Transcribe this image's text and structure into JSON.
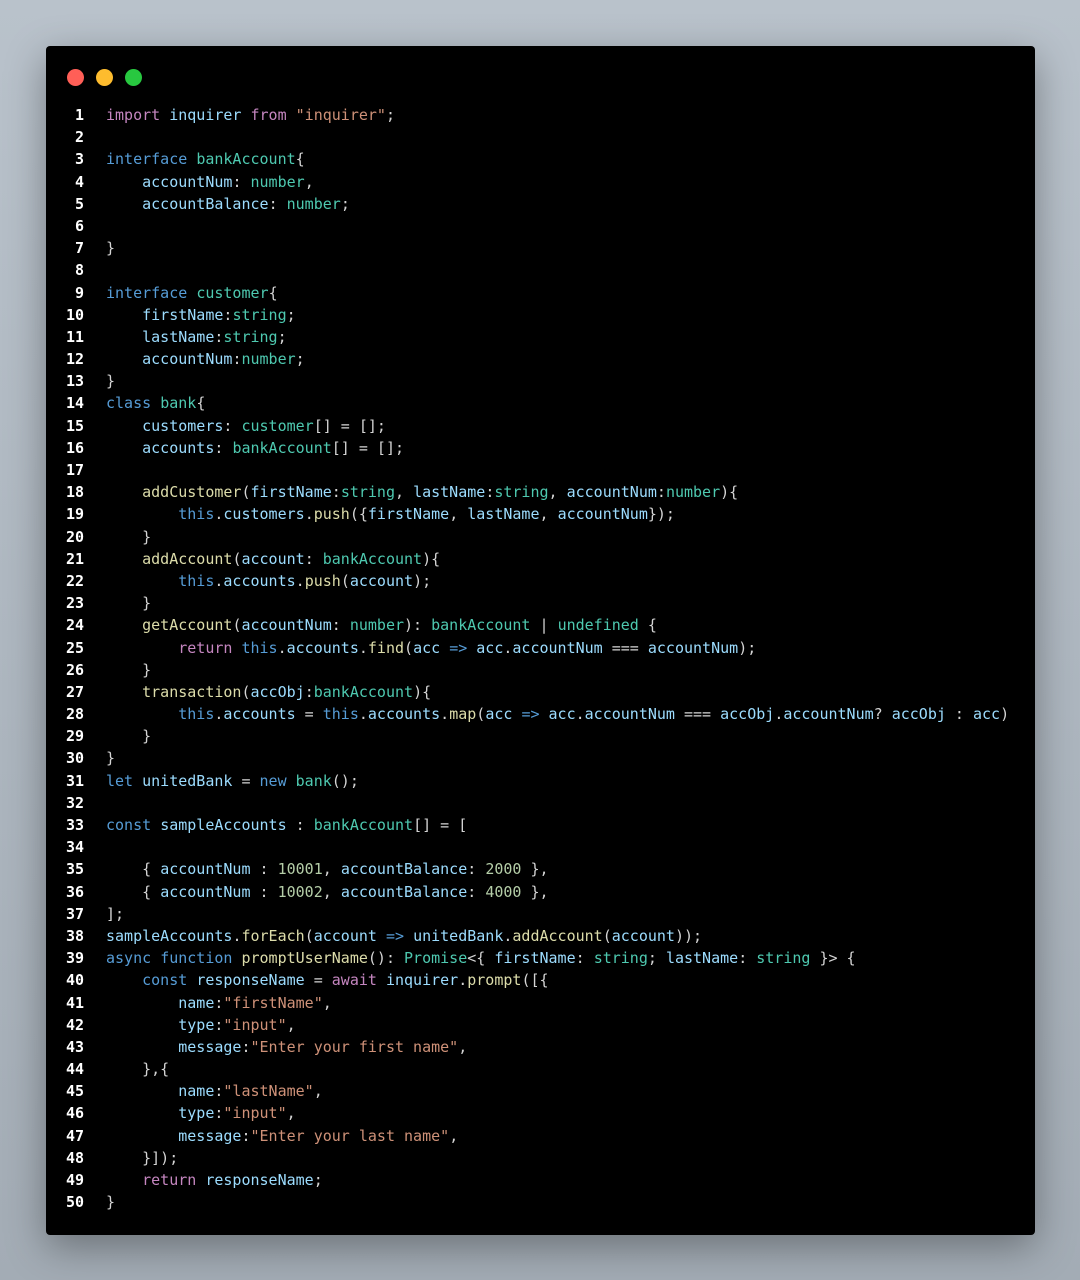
{
  "window": {
    "buttons": [
      "close",
      "minimize",
      "maximize"
    ],
    "colors": {
      "close": "#ff5f57",
      "minimize": "#febc2e",
      "maximize": "#28c840",
      "background": "#000000"
    }
  },
  "code": {
    "language": "typescript",
    "lines": [
      [
        [
          "kw",
          "import"
        ],
        [
          "pl",
          " "
        ],
        [
          "vr",
          "inquirer"
        ],
        [
          "pl",
          " "
        ],
        [
          "kw",
          "from"
        ],
        [
          "pl",
          " "
        ],
        [
          "st",
          "\"inquirer\""
        ],
        [
          "pl",
          ";"
        ]
      ],
      [],
      [
        [
          "kb",
          "interface"
        ],
        [
          "pl",
          " "
        ],
        [
          "ty",
          "bankAccount"
        ],
        [
          "pl",
          "{"
        ]
      ],
      [
        [
          "pl",
          "    "
        ],
        [
          "vr",
          "accountNum"
        ],
        [
          "pl",
          ": "
        ],
        [
          "ty",
          "number"
        ],
        [
          "pl",
          ","
        ]
      ],
      [
        [
          "pl",
          "    "
        ],
        [
          "vr",
          "accountBalance"
        ],
        [
          "pl",
          ": "
        ],
        [
          "ty",
          "number"
        ],
        [
          "pl",
          ";"
        ]
      ],
      [],
      [
        [
          "pl",
          "}"
        ]
      ],
      [],
      [
        [
          "kb",
          "interface"
        ],
        [
          "pl",
          " "
        ],
        [
          "ty",
          "customer"
        ],
        [
          "pl",
          "{"
        ]
      ],
      [
        [
          "pl",
          "    "
        ],
        [
          "vr",
          "firstName"
        ],
        [
          "pl",
          ":"
        ],
        [
          "ty",
          "string"
        ],
        [
          "pl",
          ";"
        ]
      ],
      [
        [
          "pl",
          "    "
        ],
        [
          "vr",
          "lastName"
        ],
        [
          "pl",
          ":"
        ],
        [
          "ty",
          "string"
        ],
        [
          "pl",
          ";"
        ]
      ],
      [
        [
          "pl",
          "    "
        ],
        [
          "vr",
          "accountNum"
        ],
        [
          "pl",
          ":"
        ],
        [
          "ty",
          "number"
        ],
        [
          "pl",
          ";"
        ]
      ],
      [
        [
          "pl",
          "}"
        ]
      ],
      [
        [
          "kb",
          "class"
        ],
        [
          "pl",
          " "
        ],
        [
          "ty",
          "bank"
        ],
        [
          "pl",
          "{"
        ]
      ],
      [
        [
          "pl",
          "    "
        ],
        [
          "vr",
          "customers"
        ],
        [
          "pl",
          ": "
        ],
        [
          "ty",
          "customer"
        ],
        [
          "pl",
          "[] = [];"
        ]
      ],
      [
        [
          "pl",
          "    "
        ],
        [
          "vr",
          "accounts"
        ],
        [
          "pl",
          ": "
        ],
        [
          "ty",
          "bankAccount"
        ],
        [
          "pl",
          "[] = [];"
        ]
      ],
      [],
      [
        [
          "pl",
          "    "
        ],
        [
          "fn",
          "addCustomer"
        ],
        [
          "pl",
          "("
        ],
        [
          "vr",
          "firstName"
        ],
        [
          "pl",
          ":"
        ],
        [
          "ty",
          "string"
        ],
        [
          "pl",
          ", "
        ],
        [
          "vr",
          "lastName"
        ],
        [
          "pl",
          ":"
        ],
        [
          "ty",
          "string"
        ],
        [
          "pl",
          ", "
        ],
        [
          "vr",
          "accountNum"
        ],
        [
          "pl",
          ":"
        ],
        [
          "ty",
          "number"
        ],
        [
          "pl",
          "){"
        ]
      ],
      [
        [
          "pl",
          "        "
        ],
        [
          "kb",
          "this"
        ],
        [
          "pl",
          "."
        ],
        [
          "vr",
          "customers"
        ],
        [
          "pl",
          "."
        ],
        [
          "fn",
          "push"
        ],
        [
          "pl",
          "({"
        ],
        [
          "vr",
          "firstName"
        ],
        [
          "pl",
          ", "
        ],
        [
          "vr",
          "lastName"
        ],
        [
          "pl",
          ", "
        ],
        [
          "vr",
          "accountNum"
        ],
        [
          "pl",
          "});"
        ]
      ],
      [
        [
          "pl",
          "    }"
        ]
      ],
      [
        [
          "pl",
          "    "
        ],
        [
          "fn",
          "addAccount"
        ],
        [
          "pl",
          "("
        ],
        [
          "vr",
          "account"
        ],
        [
          "pl",
          ": "
        ],
        [
          "ty",
          "bankAccount"
        ],
        [
          "pl",
          "){"
        ]
      ],
      [
        [
          "pl",
          "        "
        ],
        [
          "kb",
          "this"
        ],
        [
          "pl",
          "."
        ],
        [
          "vr",
          "accounts"
        ],
        [
          "pl",
          "."
        ],
        [
          "fn",
          "push"
        ],
        [
          "pl",
          "("
        ],
        [
          "vr",
          "account"
        ],
        [
          "pl",
          ");"
        ]
      ],
      [
        [
          "pl",
          "    }"
        ]
      ],
      [
        [
          "pl",
          "    "
        ],
        [
          "fn",
          "getAccount"
        ],
        [
          "pl",
          "("
        ],
        [
          "vr",
          "accountNum"
        ],
        [
          "pl",
          ": "
        ],
        [
          "ty",
          "number"
        ],
        [
          "pl",
          "): "
        ],
        [
          "ty",
          "bankAccount"
        ],
        [
          "pl",
          " | "
        ],
        [
          "ty",
          "undefined"
        ],
        [
          "pl",
          " {"
        ]
      ],
      [
        [
          "pl",
          "        "
        ],
        [
          "kw",
          "return"
        ],
        [
          "pl",
          " "
        ],
        [
          "kb",
          "this"
        ],
        [
          "pl",
          "."
        ],
        [
          "vr",
          "accounts"
        ],
        [
          "pl",
          "."
        ],
        [
          "fn",
          "find"
        ],
        [
          "pl",
          "("
        ],
        [
          "vr",
          "acc"
        ],
        [
          "pl",
          " "
        ],
        [
          "kb",
          "=>"
        ],
        [
          "pl",
          " "
        ],
        [
          "vr",
          "acc"
        ],
        [
          "pl",
          "."
        ],
        [
          "vr",
          "accountNum"
        ],
        [
          "pl",
          " === "
        ],
        [
          "vr",
          "accountNum"
        ],
        [
          "pl",
          ");"
        ]
      ],
      [
        [
          "pl",
          "    }"
        ]
      ],
      [
        [
          "pl",
          "    "
        ],
        [
          "fn",
          "transaction"
        ],
        [
          "pl",
          "("
        ],
        [
          "vr",
          "accObj"
        ],
        [
          "pl",
          ":"
        ],
        [
          "ty",
          "bankAccount"
        ],
        [
          "pl",
          "){"
        ]
      ],
      [
        [
          "pl",
          "        "
        ],
        [
          "kb",
          "this"
        ],
        [
          "pl",
          "."
        ],
        [
          "vr",
          "accounts"
        ],
        [
          "pl",
          " = "
        ],
        [
          "kb",
          "this"
        ],
        [
          "pl",
          "."
        ],
        [
          "vr",
          "accounts"
        ],
        [
          "pl",
          "."
        ],
        [
          "fn",
          "map"
        ],
        [
          "pl",
          "("
        ],
        [
          "vr",
          "acc"
        ],
        [
          "pl",
          " "
        ],
        [
          "kb",
          "=>"
        ],
        [
          "pl",
          " "
        ],
        [
          "vr",
          "acc"
        ],
        [
          "pl",
          "."
        ],
        [
          "vr",
          "accountNum"
        ],
        [
          "pl",
          " === "
        ],
        [
          "vr",
          "accObj"
        ],
        [
          "pl",
          "."
        ],
        [
          "vr",
          "accountNum"
        ],
        [
          "pl",
          "? "
        ],
        [
          "vr",
          "accObj"
        ],
        [
          "pl",
          " : "
        ],
        [
          "vr",
          "acc"
        ],
        [
          "pl",
          ")"
        ]
      ],
      [
        [
          "pl",
          "    }"
        ]
      ],
      [
        [
          "pl",
          "}"
        ]
      ],
      [
        [
          "kb",
          "let"
        ],
        [
          "pl",
          " "
        ],
        [
          "vr",
          "unitedBank"
        ],
        [
          "pl",
          " = "
        ],
        [
          "kb",
          "new"
        ],
        [
          "pl",
          " "
        ],
        [
          "ty",
          "bank"
        ],
        [
          "pl",
          "();"
        ]
      ],
      [],
      [
        [
          "kb",
          "const"
        ],
        [
          "pl",
          " "
        ],
        [
          "vr",
          "sampleAccounts"
        ],
        [
          "pl",
          " : "
        ],
        [
          "ty",
          "bankAccount"
        ],
        [
          "pl",
          "[] = ["
        ]
      ],
      [],
      [
        [
          "pl",
          "    { "
        ],
        [
          "vr",
          "accountNum"
        ],
        [
          "pl",
          " : "
        ],
        [
          "nm",
          "10001"
        ],
        [
          "pl",
          ", "
        ],
        [
          "vr",
          "accountBalance"
        ],
        [
          "pl",
          ": "
        ],
        [
          "nm",
          "2000"
        ],
        [
          "pl",
          " },"
        ]
      ],
      [
        [
          "pl",
          "    { "
        ],
        [
          "vr",
          "accountNum"
        ],
        [
          "pl",
          " : "
        ],
        [
          "nm",
          "10002"
        ],
        [
          "pl",
          ", "
        ],
        [
          "vr",
          "accountBalance"
        ],
        [
          "pl",
          ": "
        ],
        [
          "nm",
          "4000"
        ],
        [
          "pl",
          " },"
        ]
      ],
      [
        [
          "pl",
          "];"
        ]
      ],
      [
        [
          "vr",
          "sampleAccounts"
        ],
        [
          "pl",
          "."
        ],
        [
          "fn",
          "forEach"
        ],
        [
          "pl",
          "("
        ],
        [
          "vr",
          "account"
        ],
        [
          "pl",
          " "
        ],
        [
          "kb",
          "=>"
        ],
        [
          "pl",
          " "
        ],
        [
          "vr",
          "unitedBank"
        ],
        [
          "pl",
          "."
        ],
        [
          "fn",
          "addAccount"
        ],
        [
          "pl",
          "("
        ],
        [
          "vr",
          "account"
        ],
        [
          "pl",
          "));"
        ]
      ],
      [
        [
          "kb",
          "async"
        ],
        [
          "pl",
          " "
        ],
        [
          "kb",
          "function"
        ],
        [
          "pl",
          " "
        ],
        [
          "fn",
          "promptUserName"
        ],
        [
          "pl",
          "(): "
        ],
        [
          "ty",
          "Promise"
        ],
        [
          "pl",
          "<{ "
        ],
        [
          "vr",
          "firstName"
        ],
        [
          "pl",
          ": "
        ],
        [
          "ty",
          "string"
        ],
        [
          "pl",
          "; "
        ],
        [
          "vr",
          "lastName"
        ],
        [
          "pl",
          ": "
        ],
        [
          "ty",
          "string"
        ],
        [
          "pl",
          " }> {"
        ]
      ],
      [
        [
          "pl",
          "    "
        ],
        [
          "kb",
          "const"
        ],
        [
          "pl",
          " "
        ],
        [
          "vr",
          "responseName"
        ],
        [
          "pl",
          " = "
        ],
        [
          "kw",
          "await"
        ],
        [
          "pl",
          " "
        ],
        [
          "vr",
          "inquirer"
        ],
        [
          "pl",
          "."
        ],
        [
          "fn",
          "prompt"
        ],
        [
          "pl",
          "([{"
        ]
      ],
      [
        [
          "pl",
          "        "
        ],
        [
          "vr",
          "name"
        ],
        [
          "pl",
          ":"
        ],
        [
          "st",
          "\"firstName\""
        ],
        [
          "pl",
          ","
        ]
      ],
      [
        [
          "pl",
          "        "
        ],
        [
          "vr",
          "type"
        ],
        [
          "pl",
          ":"
        ],
        [
          "st",
          "\"input\""
        ],
        [
          "pl",
          ","
        ]
      ],
      [
        [
          "pl",
          "        "
        ],
        [
          "vr",
          "message"
        ],
        [
          "pl",
          ":"
        ],
        [
          "st",
          "\"Enter your first name\""
        ],
        [
          "pl",
          ","
        ]
      ],
      [
        [
          "pl",
          "    },{"
        ]
      ],
      [
        [
          "pl",
          "        "
        ],
        [
          "vr",
          "name"
        ],
        [
          "pl",
          ":"
        ],
        [
          "st",
          "\"lastName\""
        ],
        [
          "pl",
          ","
        ]
      ],
      [
        [
          "pl",
          "        "
        ],
        [
          "vr",
          "type"
        ],
        [
          "pl",
          ":"
        ],
        [
          "st",
          "\"input\""
        ],
        [
          "pl",
          ","
        ]
      ],
      [
        [
          "pl",
          "        "
        ],
        [
          "vr",
          "message"
        ],
        [
          "pl",
          ":"
        ],
        [
          "st",
          "\"Enter your last name\""
        ],
        [
          "pl",
          ","
        ]
      ],
      [
        [
          "pl",
          "    }]);"
        ]
      ],
      [
        [
          "pl",
          "    "
        ],
        [
          "kw",
          "return"
        ],
        [
          "pl",
          " "
        ],
        [
          "vr",
          "responseName"
        ],
        [
          "pl",
          ";"
        ]
      ],
      [
        [
          "pl",
          "}"
        ]
      ]
    ]
  }
}
